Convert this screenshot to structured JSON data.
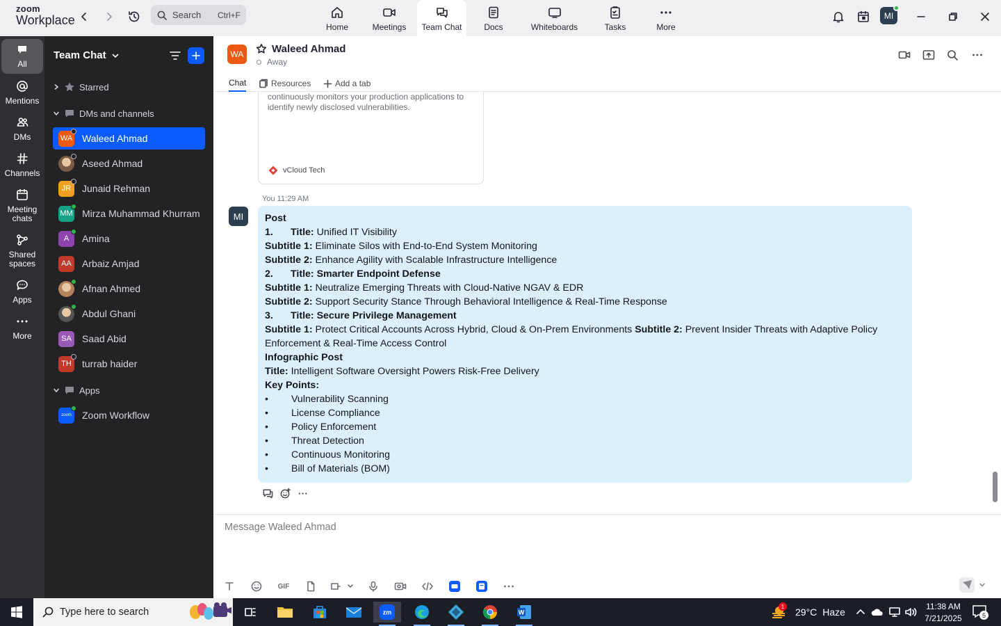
{
  "app": {
    "logo_line1": "zoom",
    "logo_line2": "Workplace"
  },
  "search": {
    "label": "Search",
    "shortcut": "Ctrl+F"
  },
  "top_tabs": [
    {
      "label": "Home",
      "icon": "home-icon"
    },
    {
      "label": "Meetings",
      "icon": "video-icon"
    },
    {
      "label": "Team Chat",
      "icon": "chat-icon",
      "active": true
    },
    {
      "label": "Docs",
      "icon": "doc-icon"
    },
    {
      "label": "Whiteboards",
      "icon": "whiteboard-icon"
    },
    {
      "label": "Tasks",
      "icon": "tasks-icon"
    },
    {
      "label": "More",
      "icon": "more-icon"
    }
  ],
  "user_avatar": "MI",
  "rail": [
    {
      "label": "All",
      "icon": "all-chat-icon",
      "active": true
    },
    {
      "label": "Mentions",
      "icon": "at-icon"
    },
    {
      "label": "DMs",
      "icon": "people-icon"
    },
    {
      "label": "Channels",
      "icon": "hash-icon"
    },
    {
      "label": "Meeting chats",
      "icon": "calendar-icon"
    },
    {
      "label": "Shared spaces",
      "icon": "shared-spaces-icon"
    },
    {
      "label": "Apps",
      "icon": "apps-icon"
    },
    {
      "label": "More",
      "icon": "more-icon"
    }
  ],
  "sidebar": {
    "title": "Team Chat",
    "starred": "Starred",
    "dms_section": "DMs and channels",
    "apps_section": "Apps",
    "dms": [
      {
        "initials": "WA",
        "name": "Waleed Ahmad",
        "color": "#ea5a12",
        "status": "away",
        "active": true
      },
      {
        "initials": "",
        "name": "Aseed Ahmad",
        "color": "#7a5a44",
        "status": "away"
      },
      {
        "initials": "JR",
        "name": "Junaid Rehman",
        "color": "#f0a020",
        "status": "away"
      },
      {
        "initials": "MM",
        "name": "Mirza Muhammad Khurram",
        "color": "#16a085",
        "status": "online"
      },
      {
        "initials": "A",
        "name": "Amina",
        "color": "#8e44ad",
        "status": "online"
      },
      {
        "initials": "AA",
        "name": "Arbaiz Amjad",
        "color": "#c0392b",
        "status": "none"
      },
      {
        "initials": "",
        "name": "Afnan Ahmed",
        "color": "#b5835a",
        "status": "online"
      },
      {
        "initials": "",
        "name": "Abdul Ghani",
        "color": "#555555",
        "status": "online"
      },
      {
        "initials": "SA",
        "name": "Saad Abid",
        "color": "#9b59b6",
        "status": "none"
      },
      {
        "initials": "TH",
        "name": "turrab haider",
        "color": "#c0392b",
        "status": "away"
      }
    ],
    "apps": [
      {
        "initials": "zoom",
        "name": "Zoom Workflow",
        "color": "#0b5cff",
        "status": "online"
      }
    ]
  },
  "chat_header": {
    "initials": "WA",
    "name": "Waleed Ahmad",
    "status": "Away",
    "tabs": [
      "Chat",
      "Resources",
      "Add a tab"
    ]
  },
  "card": {
    "text": "continuously monitors your production applications to identify newly disclosed vulnerabilities.",
    "source": "vCloud Tech"
  },
  "message": {
    "sender": "You",
    "time": "11:29 AM",
    "avatar": "MI",
    "lines": {
      "l1": "Post",
      "l2_num": "1.",
      "l2_b": "Title:",
      "l2_t": " Unified IT Visibility",
      "l3_b": "Subtitle 1:",
      "l3_t": " Eliminate Silos with End-to-End System Monitoring",
      "l4_b": "Subtitle 2:",
      "l4_t": " Enhance Agility with Scalable Infrastructure Intelligence",
      "l5_num": "2.",
      "l5_b": "Title: Smarter Endpoint Defense",
      "l6_b": "Subtitle 1:",
      "l6_t": " Neutralize Emerging Threats with Cloud-Native NGAV & EDR",
      "l7_b": "Subtitle 2:",
      "l7_t": " Support Security Stance Through Behavioral Intelligence & Real-Time Response",
      "l8_num": "3.",
      "l8_b": "Title: Secure Privilege Management",
      "l9_b": "Subtitle 1:",
      "l9_t": " Protect Critical Accounts Across Hybrid, Cloud & On-Prem Environments ",
      "l9_b2": "Subtitle 2:",
      "l9_t2": " Prevent Insider Threats with Adaptive Policy",
      "l10": "Enforcement & Real-Time Access Control",
      "l11": "Infographic Post",
      "l12_b": "Title:",
      "l12_t": " Intelligent Software Oversight Powers Risk-Free Delivery",
      "l13": "Key Points:"
    },
    "bullet": "•",
    "key_points": [
      "Vulnerability Scanning",
      "License Compliance",
      "Policy Enforcement",
      "Threat Detection",
      "Continuous Monitoring",
      "Bill of Materials (BOM)"
    ]
  },
  "composer": {
    "placeholder": "Message Waleed Ahmad",
    "gif_label": "GIF"
  },
  "taskbar": {
    "search_placeholder": "Type here to search",
    "weather_badge": "1",
    "temperature": "29°C",
    "weather": "Haze",
    "time": "11:38 AM",
    "date": "7/21/2025",
    "notifications": "5"
  }
}
